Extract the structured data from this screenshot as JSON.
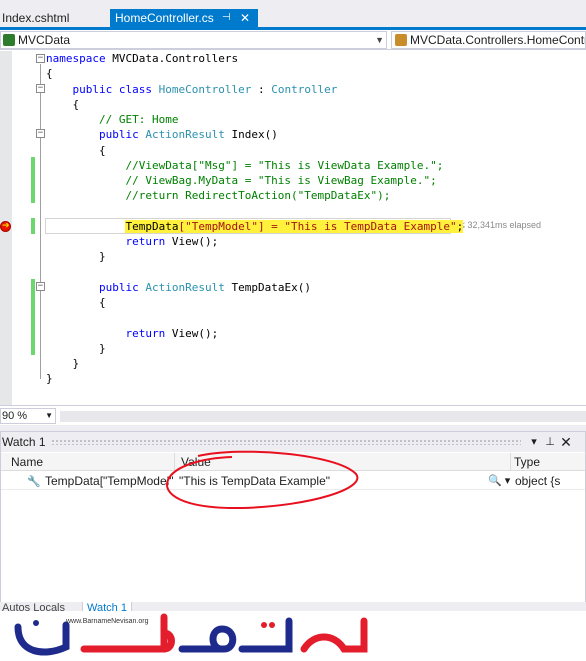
{
  "tabs": [
    {
      "label": "Index.cshtml",
      "active": false
    },
    {
      "label": "HomeController.cs",
      "active": true
    }
  ],
  "tab_icons": {
    "pin": "pin-icon",
    "close": "close-icon"
  },
  "navbar": {
    "project": "MVCData",
    "class": "MVCData.Controllers.HomeContro"
  },
  "code": {
    "lines": [
      {
        "parts": [
          [
            "kw",
            "namespace"
          ],
          [
            "pl",
            " MVCData.Controllers"
          ]
        ]
      },
      {
        "parts": [
          [
            "pl",
            "{"
          ]
        ]
      },
      {
        "parts": [
          [
            "pl",
            "    "
          ],
          [
            "kw",
            "public class"
          ],
          [
            "pl",
            " "
          ],
          [
            "ty",
            "HomeController"
          ],
          [
            "pl",
            " : "
          ],
          [
            "ty",
            "Controller"
          ]
        ]
      },
      {
        "parts": [
          [
            "pl",
            "    {"
          ]
        ]
      },
      {
        "parts": [
          [
            "pl",
            "        "
          ],
          [
            "cm",
            "// GET: Home"
          ]
        ]
      },
      {
        "parts": [
          [
            "pl",
            "        "
          ],
          [
            "kw",
            "public"
          ],
          [
            "pl",
            " "
          ],
          [
            "ty",
            "ActionResult"
          ],
          [
            "pl",
            " Index()"
          ]
        ]
      },
      {
        "parts": [
          [
            "pl",
            "        {"
          ]
        ]
      },
      {
        "parts": [
          [
            "pl",
            "            "
          ],
          [
            "cm",
            "//ViewData[\"Msg\"] = \"This is ViewData Example.\";"
          ]
        ]
      },
      {
        "parts": [
          [
            "pl",
            "            "
          ],
          [
            "cm",
            "// ViewBag.MyData = \"This is ViewBag Example.\";"
          ]
        ]
      },
      {
        "parts": [
          [
            "pl",
            "            "
          ],
          [
            "cm",
            "//return RedirectToAction(\"TempDataEx\");"
          ]
        ]
      },
      {
        "parts": [
          [
            "pl",
            ""
          ]
        ]
      },
      {
        "parts": [
          [
            "pl",
            "            "
          ],
          [
            "hl",
            "TempData"
          ],
          [
            "hlst",
            "[\"TempModel\"] = \"This is TempData Example\""
          ],
          [
            "hl",
            ";"
          ]
        ]
      },
      {
        "parts": [
          [
            "pl",
            "            "
          ],
          [
            "kw",
            "return"
          ],
          [
            "pl",
            " View();"
          ]
        ]
      },
      {
        "parts": [
          [
            "pl",
            "        }"
          ]
        ]
      },
      {
        "parts": [
          [
            "pl",
            ""
          ]
        ]
      },
      {
        "parts": [
          [
            "pl",
            "        "
          ],
          [
            "kw",
            "public"
          ],
          [
            "pl",
            " "
          ],
          [
            "ty",
            "ActionResult"
          ],
          [
            "pl",
            " TempDataEx()"
          ]
        ]
      },
      {
        "parts": [
          [
            "pl",
            "        {"
          ]
        ]
      },
      {
        "parts": [
          [
            "pl",
            ""
          ]
        ]
      },
      {
        "parts": [
          [
            "pl",
            "            "
          ],
          [
            "kw",
            "return"
          ],
          [
            "pl",
            " View();"
          ]
        ]
      },
      {
        "parts": [
          [
            "pl",
            "        }"
          ]
        ]
      },
      {
        "parts": [
          [
            "pl",
            "    }"
          ]
        ]
      },
      {
        "parts": [
          [
            "pl",
            "}"
          ]
        ]
      }
    ],
    "elapsed": "≤ 32,341ms elapsed"
  },
  "zoom": "90 %",
  "watch": {
    "title": "Watch 1",
    "columns": {
      "name": "Name",
      "value": "Value",
      "type": "Type"
    },
    "rows": [
      {
        "name": "TempData[\"TempModel\"]",
        "value": "\"This is TempData Example\"",
        "type": "object {s"
      }
    ]
  },
  "bottom_tabs": [
    "Autos",
    "Locals",
    "Watch 1"
  ],
  "logo": {
    "url": "www.BarnameNevisan.org",
    "wordmark": "برنامه نویسان"
  },
  "colors": {
    "accent": "#007acc",
    "keyword": "#0000ff",
    "type": "#2b91af",
    "comment": "#008000",
    "string": "#a31515",
    "highlight": "#fff13c",
    "annotation": "#e8101e"
  }
}
